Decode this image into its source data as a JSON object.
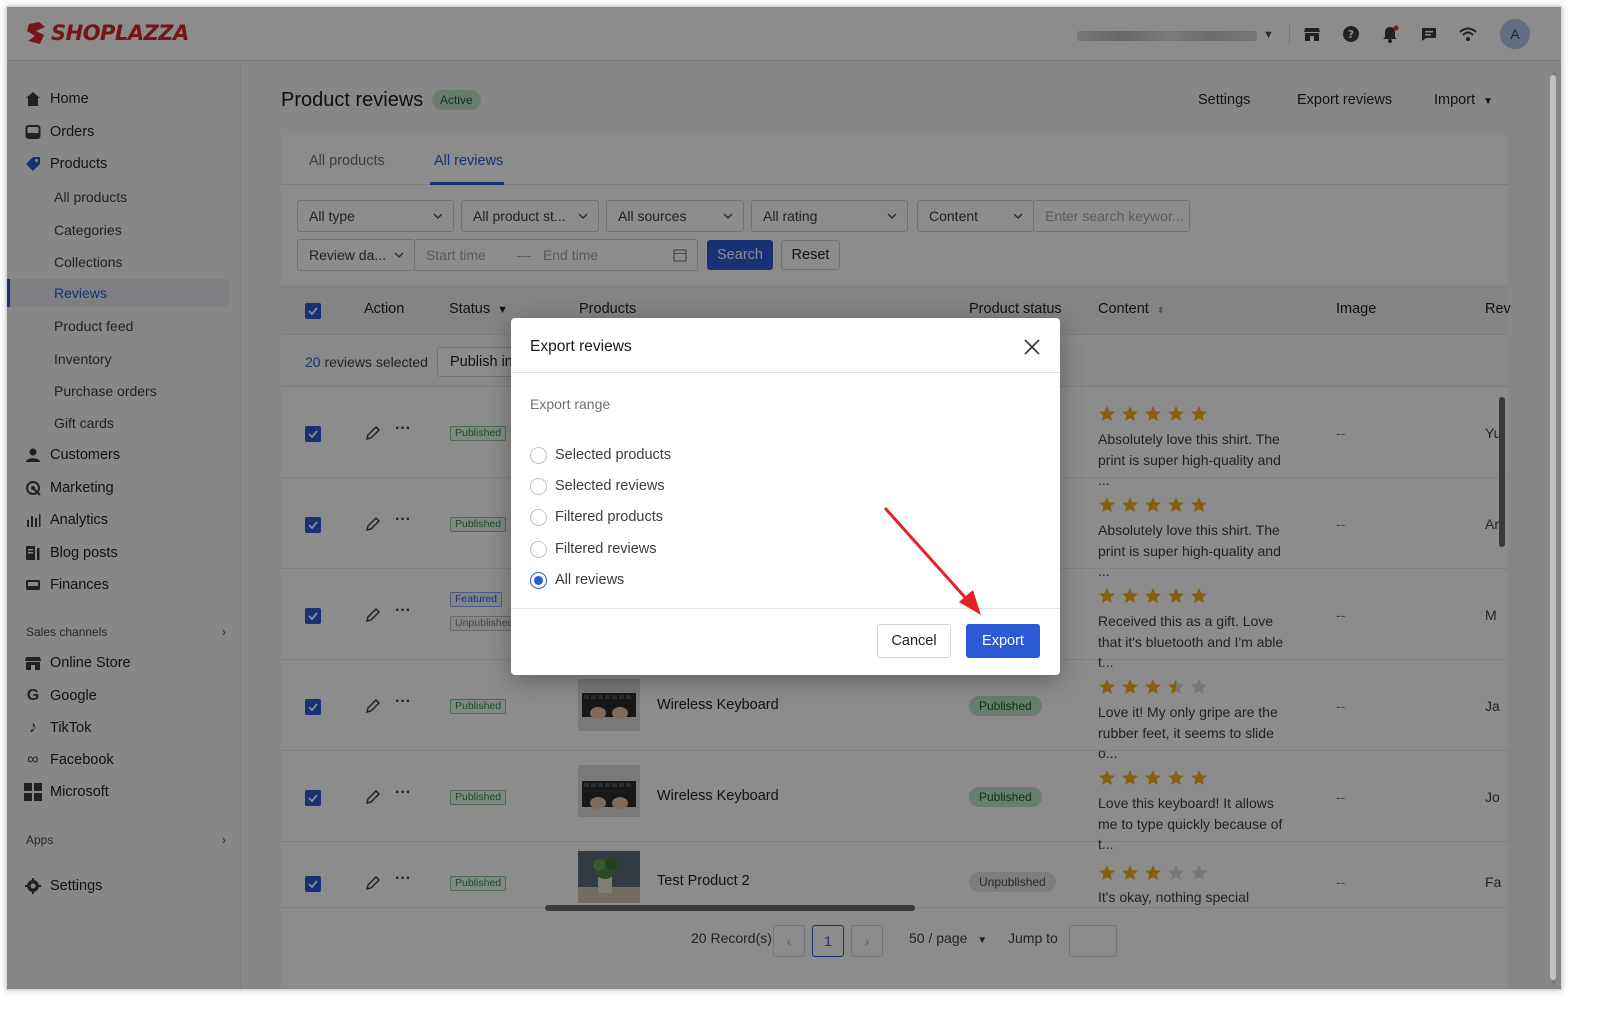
{
  "brand": {
    "name": "SHOPLAZZA",
    "color": "#d7262f"
  },
  "accent": "#2c5ad6",
  "topbar": {
    "avatar_letter": "A",
    "icons": [
      "store-icon",
      "help-icon",
      "bell-icon",
      "chat-icon",
      "wifi-icon"
    ]
  },
  "sidebar": {
    "items": [
      {
        "label": "Home",
        "icon": "home-icon"
      },
      {
        "label": "Orders",
        "icon": "orders-icon"
      },
      {
        "label": "Products",
        "icon": "tag-icon"
      },
      {
        "label": "Customers",
        "icon": "person-icon"
      },
      {
        "label": "Marketing",
        "icon": "megaphone-icon"
      },
      {
        "label": "Analytics",
        "icon": "bar-chart-icon"
      },
      {
        "label": "Blog posts",
        "icon": "blog-icon"
      },
      {
        "label": "Finances",
        "icon": "wallet-icon"
      }
    ],
    "product_subitems": [
      "All products",
      "Categories",
      "Collections",
      "Reviews",
      "Product feed",
      "Inventory",
      "Purchase orders",
      "Gift cards"
    ],
    "active_subitem": "Reviews",
    "sales_channels_label": "Sales channels",
    "channels": [
      {
        "label": "Online Store",
        "icon": "store-icon"
      },
      {
        "label": "Google",
        "icon": "google-icon"
      },
      {
        "label": "TikTok",
        "icon": "tiktok-icon"
      },
      {
        "label": "Facebook",
        "icon": "meta-icon"
      },
      {
        "label": "Microsoft",
        "icon": "microsoft-icon"
      }
    ],
    "apps_label": "Apps",
    "settings_label": "Settings"
  },
  "header": {
    "title": "Product reviews",
    "badge": "Active",
    "actions": {
      "settings": "Settings",
      "export": "Export reviews",
      "import": "Import"
    }
  },
  "tabs": {
    "all_products": "All products",
    "all_reviews": "All reviews"
  },
  "filters": {
    "type": "All type",
    "product_status": "All product st...",
    "sources": "All sources",
    "rating": "All rating",
    "search_field": "Content",
    "search_placeholder": "Enter search keywor...",
    "date_field": "Review da...",
    "start_placeholder": "Start time",
    "end_placeholder": "End time",
    "date_separator": "—",
    "search_button": "Search",
    "reset_button": "Reset"
  },
  "table": {
    "columns": {
      "action": "Action",
      "status": "Status",
      "products": "Products",
      "product_status": "Product status",
      "content": "Content",
      "image": "Image",
      "reviewer": "Rev"
    },
    "selection": {
      "count": "20",
      "suffix": "reviews selected",
      "bulk_button": "Publish in"
    },
    "rows": [
      {
        "tags": [
          "Published"
        ],
        "product": "",
        "product_status": "",
        "rating": 5,
        "content": "Absolutely love this shirt. The print is super high-quality and ...",
        "image": "--",
        "reviewer": "Yu"
      },
      {
        "tags": [
          "Published"
        ],
        "product": "",
        "product_status": "",
        "rating": 5,
        "content": "Absolutely love this shirt. The print is super high-quality and ...",
        "image": "--",
        "reviewer": "Ar"
      },
      {
        "tags": [
          "Featured",
          "Unpublished"
        ],
        "product": "",
        "product_status": "",
        "rating": 5,
        "content": "Received this as a gift. Love that it's bluetooth and I'm able t...",
        "image": "--",
        "reviewer": "M"
      },
      {
        "tags": [
          "Published"
        ],
        "product": "Wireless Keyboard",
        "product_status": "Published",
        "rating": 3.5,
        "content": "Love it! My only gripe are the rubber feet, it seems to slide o...",
        "image": "--",
        "reviewer": "Ja"
      },
      {
        "tags": [
          "Published"
        ],
        "product": "Wireless Keyboard",
        "product_status": "Published",
        "rating": 5,
        "content": "Love this keyboard! It allows me to type quickly because of t...",
        "image": "--",
        "reviewer": "Jo"
      },
      {
        "tags": [
          "Published"
        ],
        "product": "Test Product 2",
        "product_status": "Unpublished",
        "rating": 3,
        "content": "It's okay, nothing special",
        "image": "--",
        "reviewer": "Fa"
      }
    ]
  },
  "pagination": {
    "records": "20 Record(s)",
    "current_page": "1",
    "page_size": "50 / page",
    "jump_label": "Jump to"
  },
  "modal": {
    "title": "Export reviews",
    "range_label": "Export range",
    "options": [
      "Selected products",
      "Selected reviews",
      "Filtered products",
      "Filtered reviews",
      "All reviews"
    ],
    "selected_option": "All reviews",
    "cancel": "Cancel",
    "export": "Export"
  }
}
